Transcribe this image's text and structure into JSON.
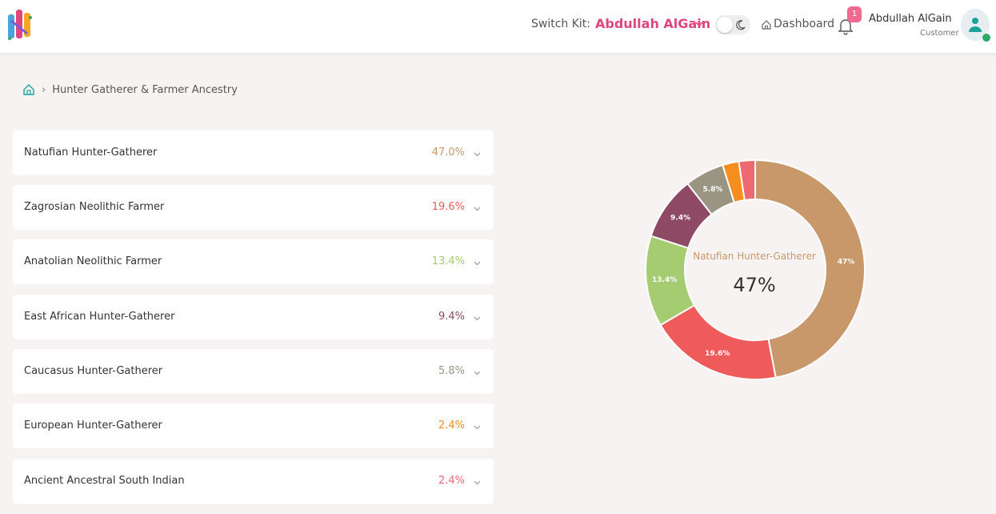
{
  "header": {
    "switch_label": "Switch Kit:",
    "kit_name": "Abdullah AlGain",
    "dashboard_label": "Dashboard",
    "notification_count": "1",
    "user_name": "Abdullah AlGain",
    "user_role": "Customer",
    "icons": [
      "logo",
      "chevron-down-icon",
      "moon-icon",
      "home-icon",
      "bell-icon",
      "user-icon"
    ]
  },
  "breadcrumb": {
    "current": "Hunter Gatherer & Farmer Ancestry"
  },
  "ancestry": [
    {
      "name": "Natufian Hunter-Gatherer",
      "percent": "47.0%",
      "color": "#c8986a"
    },
    {
      "name": "Zagrosian Neolithic Farmer",
      "percent": "19.6%",
      "color": "#ef5a5a"
    },
    {
      "name": "Anatolian Neolithic Farmer",
      "percent": "13.4%",
      "color": "#a6cc72"
    },
    {
      "name": "East African Hunter-Gatherer",
      "percent": "9.4%",
      "color": "#8e4a65"
    },
    {
      "name": "Caucasus Hunter-Gatherer",
      "percent": "5.8%",
      "color": "#9a9582"
    },
    {
      "name": "European Hunter-Gatherer",
      "percent": "2.4%",
      "color": "#f58e1e"
    },
    {
      "name": "Ancient Ancestral South Indian",
      "percent": "2.4%",
      "color": "#ee6a72"
    }
  ],
  "chart_data": {
    "type": "pie",
    "categories": [
      "Natufian Hunter-Gatherer",
      "Zagrosian Neolithic Farmer",
      "Anatolian Neolithic Farmer",
      "East African Hunter-Gatherer",
      "Caucasus Hunter-Gatherer",
      "European Hunter-Gatherer",
      "Ancient Ancestral South Indian"
    ],
    "values": [
      47,
      19.6,
      13.4,
      9.4,
      5.8,
      2.4,
      2.4
    ],
    "slice_labels": [
      "47%",
      "19.6%",
      "13.4%",
      "9.4%",
      "5.8%",
      "",
      ""
    ],
    "colors": [
      "#c8986a",
      "#ef5a5a",
      "#a6cc72",
      "#8e4a65",
      "#9a9582",
      "#f58e1e",
      "#ee6a72"
    ],
    "donut": true,
    "center_label": "Natufian Hunter-Gatherer",
    "center_value": "47%"
  }
}
